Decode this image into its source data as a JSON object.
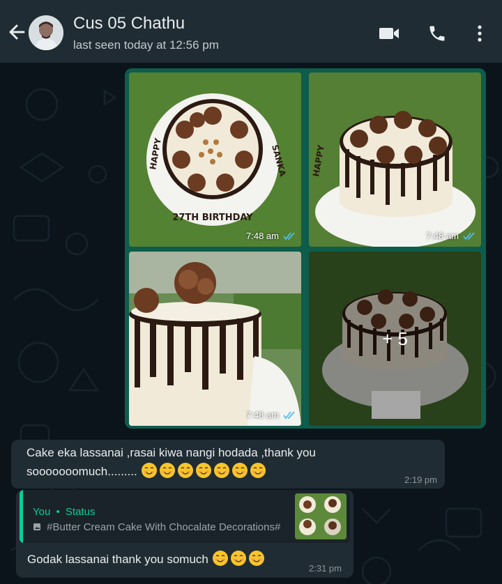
{
  "header": {
    "contact_name": "Cus 05 Chathu",
    "last_seen": "last seen today at 12:56 pm",
    "icons": [
      "back-arrow-icon",
      "avatar",
      "video-call-icon",
      "voice-call-icon",
      "more-options-icon"
    ]
  },
  "media": {
    "tiles": [
      {
        "time": "7:48 am",
        "status": "read-ticks"
      },
      {
        "time": "7:48 am",
        "status": "read-ticks"
      },
      {
        "time": "7:48 am",
        "status": "read-ticks"
      },
      {
        "more": "+ 5"
      }
    ],
    "cake_text": [
      "HAPPY",
      "27TH BIRTHDAY",
      "SANKA"
    ]
  },
  "messages": [
    {
      "text_line1": "Cake eka lassanai ,rasai kiwa nangi hodada ,thank you",
      "text_line2": "sooooooomuch.........",
      "emoji_count": 7,
      "time": "2:19 pm"
    },
    {
      "quote_sender": "You",
      "quote_type": "Status",
      "quote_text": "#Butter Cream Cake With Chocalate Decorations#",
      "text": "Godak lassanai thank you somuch",
      "emoji_count": 3,
      "time": "2:31 pm"
    }
  ],
  "colors": {
    "header_bg": "#1f2c34",
    "chat_bg": "#0b141a",
    "outgoing_bubble": "#0e5c4c",
    "incoming_bubble": "#202c33",
    "accent": "#06cf9c",
    "read_tick": "#53bdeb"
  }
}
